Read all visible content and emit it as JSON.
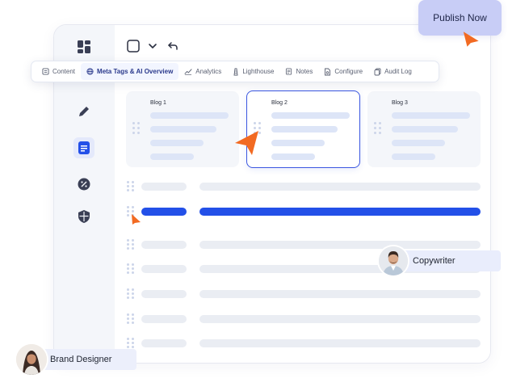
{
  "publish_button": {
    "label": "Publish Now"
  },
  "tabs": [
    {
      "label": "Content",
      "icon": "document-icon"
    },
    {
      "label": "Meta Tags & AI Overview",
      "icon": "globe-icon",
      "active": true
    },
    {
      "label": "Analytics",
      "icon": "trend-icon"
    },
    {
      "label": "Lighthouse",
      "icon": "lighthouse-icon"
    },
    {
      "label": "Notes",
      "icon": "notes-icon"
    },
    {
      "label": "Configure",
      "icon": "file-cog-icon"
    },
    {
      "label": "Audit Log",
      "icon": "copy-icon"
    }
  ],
  "blogs": [
    {
      "title": "Blog 1"
    },
    {
      "title": "Blog 2",
      "selected": true
    },
    {
      "title": "Blog 3"
    }
  ],
  "collaborators": {
    "copywriter": {
      "label": "Copywriter"
    },
    "brand_designer": {
      "label": "Brand Designer"
    }
  },
  "colors": {
    "accent": "#2350e8",
    "cursor": "#f26a22",
    "publish_bg": "#c8cdf6",
    "chip_bg": "#e9edfc"
  }
}
